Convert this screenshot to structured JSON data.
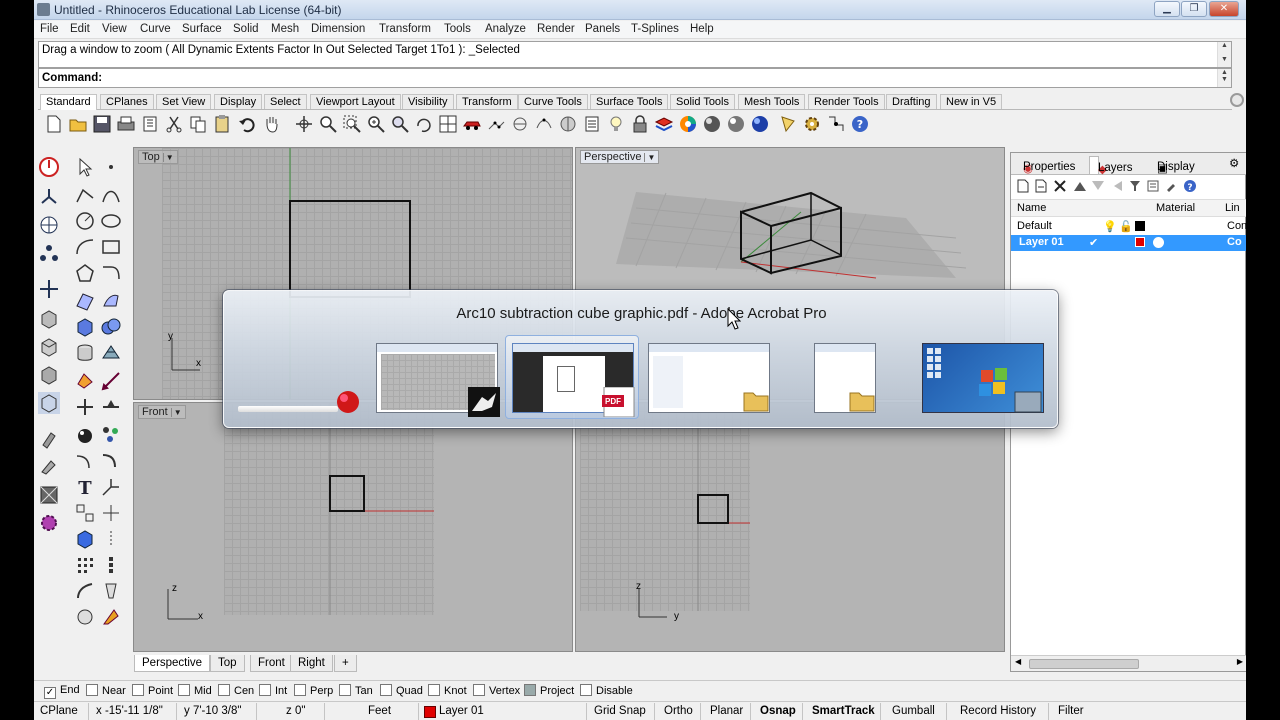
{
  "window": {
    "title": "Untitled - Rhinoceros Educational Lab License (64-bit)",
    "minimize": "0",
    "maximize": "1",
    "close": "r"
  },
  "menu": [
    "File",
    "Edit",
    "View",
    "Curve",
    "Surface",
    "Solid",
    "Mesh",
    "Dimension",
    "Transform",
    "Tools",
    "Analyze",
    "Render",
    "Panels",
    "T-Splines",
    "Help"
  ],
  "command": {
    "history": "Drag a window to zoom ( All  Dynamic  Extents  Factor  In  Out  Selected  Target  1To1 ): _Selected",
    "prompt": "Command:"
  },
  "toolbar_tabs": [
    "Standard",
    "CPlanes",
    "Set View",
    "Display",
    "Select",
    "Viewport Layout",
    "Visibility",
    "Transform",
    "Curve Tools",
    "Surface Tools",
    "Solid Tools",
    "Mesh Tools",
    "Render Tools",
    "Drafting",
    "New in V5"
  ],
  "viewports": {
    "top": {
      "label": "Top"
    },
    "perspective": {
      "label": "Perspective"
    },
    "front": {
      "label": "Front"
    },
    "right": {
      "label": ""
    },
    "axis_x": "x",
    "axis_y": "y",
    "axis_z": "z"
  },
  "viewport_tabs": [
    "Perspective",
    "Top",
    "Front",
    "Right"
  ],
  "viewport_tab_add": "+",
  "panel": {
    "tabs": [
      "Properties",
      "Layers",
      "Display"
    ],
    "columns": {
      "name": "Name",
      "material": "Material",
      "linetype": "Lin"
    },
    "layers": [
      {
        "name": "Default",
        "linetype": "Con",
        "color": "#000000",
        "current": false
      },
      {
        "name": "Layer 01",
        "linetype": "Co",
        "color": "#e00000",
        "current": true
      }
    ],
    "current_mark": "✔"
  },
  "snaps": [
    {
      "label": "End",
      "checked": true
    },
    {
      "label": "Near",
      "checked": false
    },
    {
      "label": "Point",
      "checked": false
    },
    {
      "label": "Mid",
      "checked": false
    },
    {
      "label": "Cen",
      "checked": false
    },
    {
      "label": "Int",
      "checked": false
    },
    {
      "label": "Perp",
      "checked": false
    },
    {
      "label": "Tan",
      "checked": false
    },
    {
      "label": "Quad",
      "checked": false
    },
    {
      "label": "Knot",
      "checked": false
    },
    {
      "label": "Vertex",
      "checked": false
    },
    {
      "label": "Project",
      "checked": false
    },
    {
      "label": "Disable",
      "checked": false
    }
  ],
  "status": {
    "cplane": "CPlane",
    "x": "x -15'-11 1/8\"",
    "y": "y 7'-10 3/8\"",
    "z": "z 0\"",
    "units": "Feet",
    "layer": "Layer 01",
    "layer_color": "#e00000",
    "toggles": [
      "Grid Snap",
      "Ortho",
      "Planar",
      "Osnap",
      "SmartTrack",
      "Gumball",
      "Record History",
      "Filter"
    ]
  },
  "switcher": {
    "title": "Arc10 subtraction cube graphic.pdf - Adobe Acrobat Pro",
    "pdf_badge": "PDF"
  }
}
